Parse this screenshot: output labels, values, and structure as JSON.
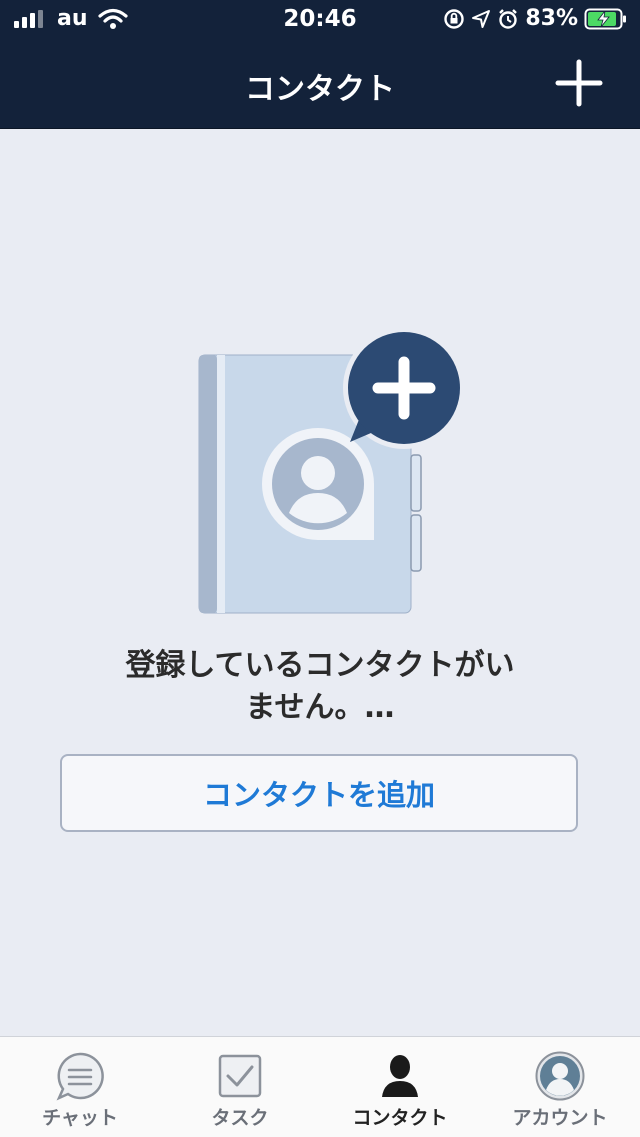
{
  "status_bar": {
    "carrier": "au",
    "time": "20:46",
    "battery": "83%"
  },
  "nav": {
    "title": "コンタクト"
  },
  "empty_state": {
    "message_line1": "登録しているコンタクトがい",
    "message_line2": "ません。…",
    "add_button_label": "コンタクトを追加"
  },
  "tabs": [
    {
      "label": "チャット",
      "icon": "chat-icon"
    },
    {
      "label": "タスク",
      "icon": "task-icon"
    },
    {
      "label": "コンタクト",
      "icon": "contact-icon",
      "active": true
    },
    {
      "label": "アカウント",
      "icon": "account-icon"
    }
  ],
  "colors": {
    "header": "#13223a",
    "background": "#e9ecf3",
    "accent": "#1f7ad6"
  }
}
